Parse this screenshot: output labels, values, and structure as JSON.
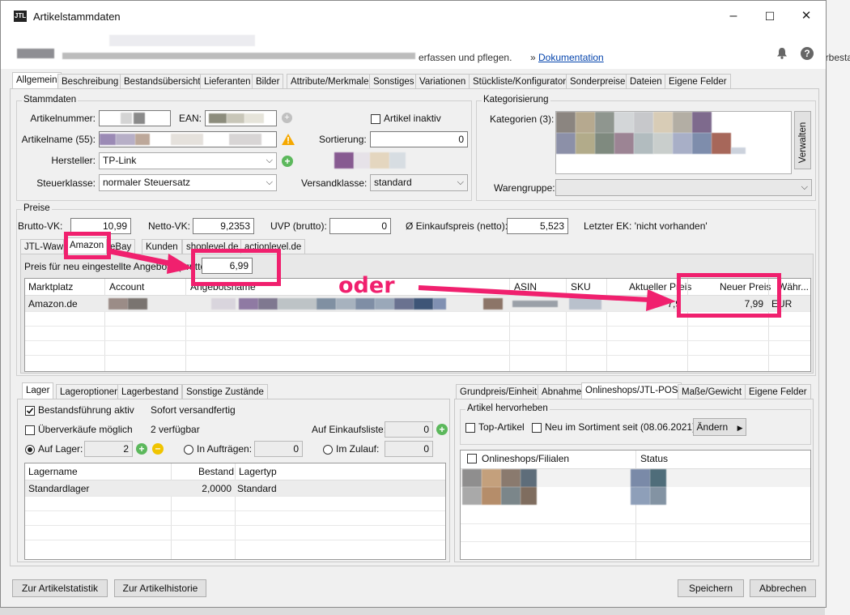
{
  "window": {
    "title": "Artikelstammdaten",
    "app_icon": "JTL",
    "controls": [
      "–",
      "☐",
      "✕"
    ]
  },
  "header": {
    "description_tail": "erfassen und pflegen.",
    "doc_prefix": "»",
    "doc_link": "Dokumentation"
  },
  "background": {
    "right_edge_text": "erbesta"
  },
  "main_tabs": [
    "Allgemein",
    "Beschreibung",
    "Bestandsübersicht",
    "Lieferanten",
    "Bilder",
    "Attribute/Merkmale",
    "Sonstiges",
    "Variationen",
    "Stückliste/Konfigurator",
    "Sonderpreise",
    "Dateien",
    "Eigene Felder"
  ],
  "stammdaten": {
    "group": "Stammdaten",
    "artikelnummer_label": "Artikelnummer:",
    "ean_label": "EAN:",
    "artikel_inaktiv_label": "Artikel inaktiv",
    "artikelname_label": "Artikelname (55):",
    "sortierung_label": "Sortierung:",
    "sortierung_value": "0",
    "hersteller_label": "Hersteller:",
    "hersteller_value": "TP-Link",
    "steuerklasse_label": "Steuerklasse:",
    "steuerklasse_value": "normaler Steuersatz",
    "versandklasse_label": "Versandklasse:",
    "versandklasse_value": "standard"
  },
  "kategorisierung": {
    "group": "Kategorisierung",
    "kategorien_label": "Kategorien (3):",
    "verwalten_button": "Verwalten",
    "warengruppe_label": "Warengruppe:"
  },
  "preise": {
    "group": "Preise",
    "brutto_label": "Brutto-VK:",
    "brutto_value": "10,99",
    "netto_label": "Netto-VK:",
    "netto_value": "9,2353",
    "uvp_label": "UVP (brutto):",
    "uvp_value": "0",
    "ek_label": "Ø Einkaufspreis (netto):",
    "ek_value": "5,523",
    "letzter_ek": "Letzter EK: 'nicht vorhanden'"
  },
  "channel_tabs": [
    "JTL-Waw",
    "Amazon",
    "eBay",
    "Kunden",
    "shoplevel.de",
    "actionlevel.de"
  ],
  "amazon": {
    "neu_label": "Preis für neu eingestellte Angebote (brutto",
    "neu_value": "6,99",
    "columns": [
      "Marktplatz",
      "Account",
      "Angebotsname",
      "ASIN",
      "SKU",
      "Aktueller Preis",
      "Neuer Preis",
      "Währ..."
    ],
    "row": {
      "marktplatz": "Amazon.de",
      "aktueller_preis": "7,9",
      "neuer_preis": "7,99",
      "waehrung": "EUR"
    },
    "annotation": "oder"
  },
  "lager_tabs": [
    "Lager",
    "Lageroptionen",
    "Lagerbestand",
    "Sonstige Zustände"
  ],
  "lager": {
    "bestandsfuehrung": "Bestandsführung aktiv",
    "sofort": "Sofort versandfertig",
    "ueberverkaeufe": "Überverkäufe möglich",
    "verfuegbar": "2  verfügbar",
    "auf_einkaufsliste": "Auf Einkaufsliste:",
    "einkaufsliste_value": "0",
    "auf_lager": "Auf Lager:",
    "auf_lager_value": "2",
    "in_auftraegen": "In Aufträgen:",
    "auftraege_value": "0",
    "im_zulauf": "Im Zulauf:",
    "zulauf_value": "0",
    "columns": [
      "Lagername",
      "Bestand",
      "Lagertyp"
    ],
    "row": {
      "name": "Standardlager",
      "bestand": "2,0000",
      "typ": "Standard"
    }
  },
  "right_tabs": [
    "Grundpreis/Einheit",
    "Abnahme",
    "Onlineshops/JTL-POS",
    "Maße/Gewicht",
    "Eigene Felder"
  ],
  "onlineshops": {
    "group": "Artikel hervorheben",
    "top_artikel": "Top-Artikel",
    "neu_im_sortiment": "Neu im Sortiment seit (08.06.2021)",
    "aendern_button": "Ändern",
    "columns": [
      "Onlineshops/Filialen",
      "Status"
    ]
  },
  "footer": {
    "statistik": "Zur Artikelstatistik",
    "historie": "Zur Artikelhistorie",
    "speichern": "Speichern",
    "abbrechen": "Abbrechen"
  },
  "colors": {
    "annotation_pink": "#f0206e",
    "link_blue": "#0645ad",
    "selected_row": "#e9e9e9"
  },
  "icons": [
    "jtl-logo-icon",
    "bell-icon",
    "help-icon",
    "warning-icon",
    "plus-icon",
    "minus-icon",
    "chevron-down-icon",
    "arrow-right-icon"
  ]
}
